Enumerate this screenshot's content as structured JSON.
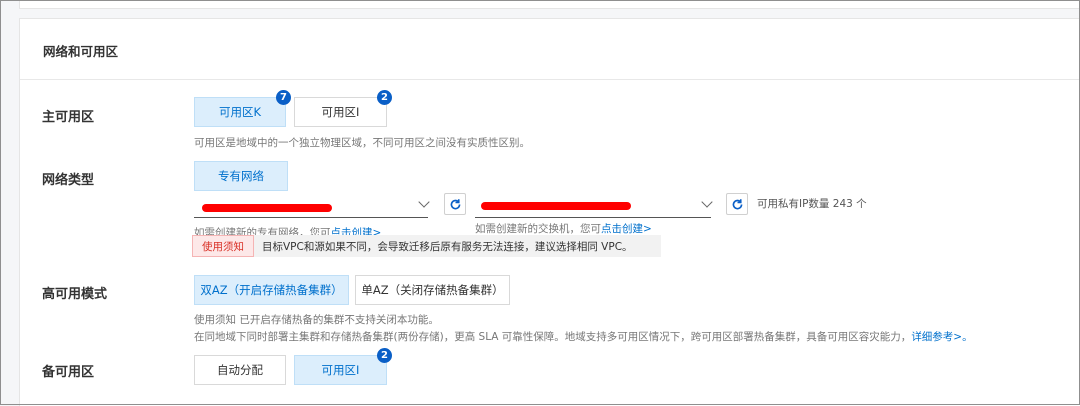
{
  "section": {
    "title": "网络和可用区"
  },
  "primary_zone": {
    "label": "主可用区",
    "options": [
      {
        "label": "可用区K",
        "badge": "7",
        "selected": true
      },
      {
        "label": "可用区I",
        "badge": "2",
        "selected": false
      }
    ],
    "hint": "可用区是地域中的一个独立物理区域，不同可用区之间没有实质性区别。"
  },
  "network_type": {
    "label": "网络类型",
    "option": "专有网络",
    "vpc_hint_prefix": "如需创建新的专有网络，您可",
    "vpc_hint_link": "点击创建>",
    "vswitch_hint_prefix": "如需创建新的交换机，您可",
    "vswitch_hint_link": "点击创建>",
    "available_ips": "可用私有IP数量 243 个",
    "notice_tag": "使用须知",
    "notice_text": "目标VPC和源如果不同，会导致迁移后原有服务无法连接，建议选择相同 VPC。"
  },
  "ha_mode": {
    "label": "高可用模式",
    "options": [
      {
        "label": "双AZ（开启存储热备集群）",
        "selected": true
      },
      {
        "label": "单AZ（关闭存储热备集群）",
        "selected": false
      }
    ],
    "hint1": "使用须知 已开启存储热备的集群不支持关闭本功能。",
    "hint2": "在同地域下同时部署主集群和存储热备集群(两份存储)，更高 SLA 可靠性保障。地域支持多可用区情况下，跨可用区部署热备集群，具备可用区容灾能力，",
    "hint2_link": "详细参考>。"
  },
  "backup_zone": {
    "label": "备可用区",
    "options": [
      {
        "label": "自动分配",
        "selected": false
      },
      {
        "label": "可用区I",
        "badge": "2",
        "selected": true
      }
    ]
  },
  "icons": {
    "dropdown": "chevron-down-icon",
    "refresh": "refresh-icon"
  },
  "colors": {
    "accent": "#0070cc",
    "badge": "#0a5fc7",
    "selected_bg": "#dceefc",
    "redaction": "#ff0000",
    "notice_tag": "#d93026"
  }
}
